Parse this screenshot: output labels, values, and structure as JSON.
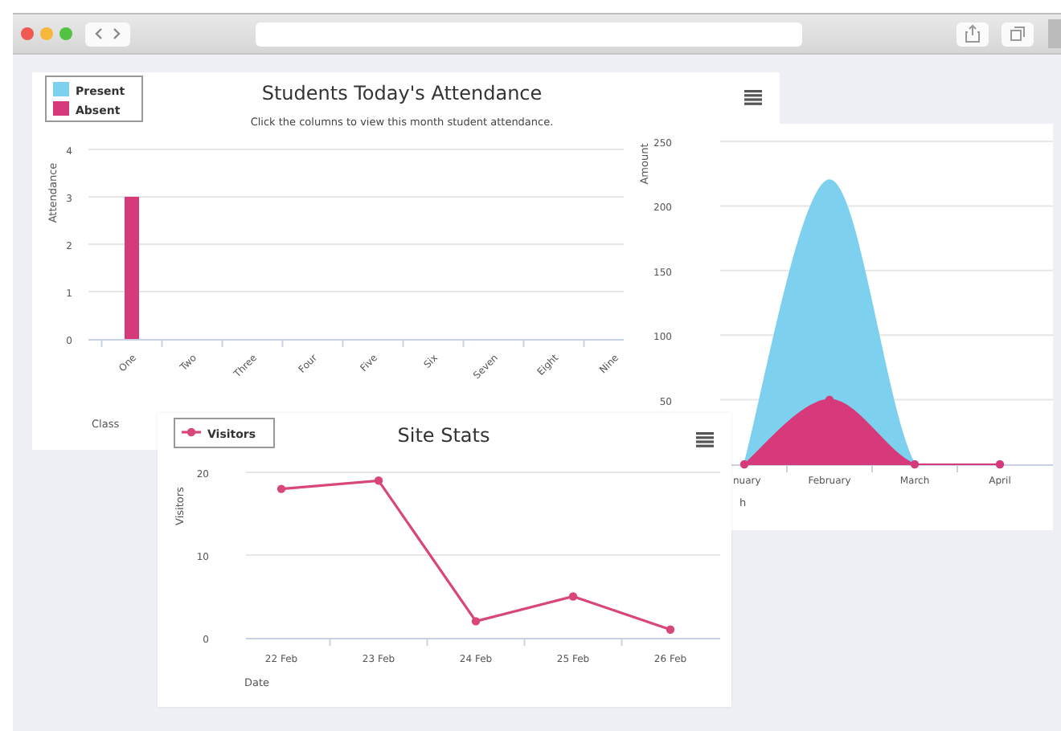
{
  "panels": [
    {
      "kind": "bar",
      "menu_button": true,
      "subtitle": "Click the columns to view this month student attendance.",
      "chart_data": {
        "type": "bar",
        "title": "Students Today's Attendance",
        "xlabel": "Class",
        "ylabel": "Attendance",
        "categories": [
          "One",
          "Two",
          "Three",
          "Four",
          "Five",
          "Six",
          "Seven",
          "Eight",
          "Nine"
        ],
        "series": [
          {
            "name": "Present",
            "color": "#7dd0ee",
            "values": [
              0,
              0,
              0,
              0,
              0,
              0,
              0,
              0,
              0
            ]
          },
          {
            "name": "Absent",
            "color": "#d63a7a",
            "values": [
              3,
              0,
              0,
              0,
              0,
              0,
              0,
              0,
              0
            ]
          }
        ],
        "ylim": [
          0,
          4
        ],
        "yticks": [
          0,
          1,
          2,
          3,
          4
        ],
        "grid": true
      }
    },
    {
      "kind": "area",
      "chart_data": {
        "type": "area",
        "xlabel": "h",
        "ylabel": "Amount",
        "categories": [
          "nuary",
          "February",
          "March",
          "April"
        ],
        "series": [
          {
            "color": "#7dd0ee",
            "values": [
              0,
              220,
              0,
              0
            ]
          },
          {
            "color": "#d63a7a",
            "marker": true,
            "values": [
              0,
              50,
              0,
              0
            ]
          }
        ],
        "ylim": [
          0,
          250
        ],
        "yticks": [
          50,
          100,
          150,
          200,
          250
        ],
        "grid": true
      }
    },
    {
      "kind": "line",
      "menu_button": true,
      "chart_data": {
        "type": "line",
        "title": "Site Stats",
        "xlabel": "Date",
        "ylabel": "Visitors",
        "categories": [
          "22 Feb",
          "23 Feb",
          "24 Feb",
          "25 Feb",
          "26 Feb"
        ],
        "series": [
          {
            "name": "Visitors",
            "color": "#d9467a",
            "marker": true,
            "values": [
              18,
              19,
              2,
              5,
              1
            ]
          }
        ],
        "ylim": [
          0,
          20
        ],
        "yticks": [
          0,
          10,
          20
        ],
        "grid": true
      }
    }
  ]
}
